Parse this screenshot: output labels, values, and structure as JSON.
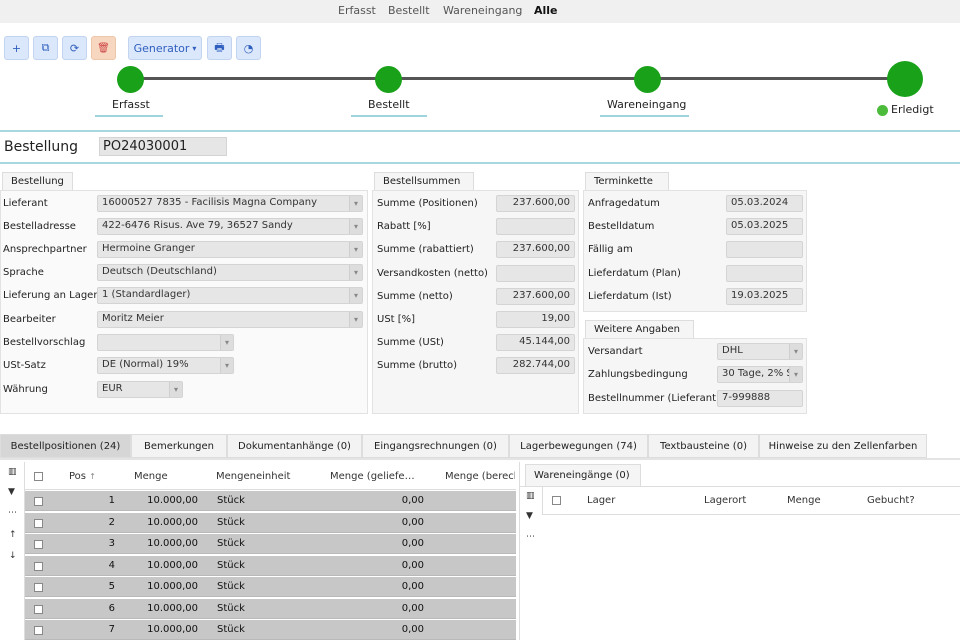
{
  "nav": {
    "items": [
      "Erfasst",
      "Bestellt",
      "Wareneingang",
      "Alle"
    ],
    "active": "Alle"
  },
  "toolbar": {
    "add": "+",
    "copy": "⧉",
    "refresh": "⟳",
    "delete": "🗑",
    "generator": "Generator",
    "generator_caret": "▾",
    "print": "🖶",
    "chart": "◔"
  },
  "progress": {
    "stages": [
      "Erfasst",
      "Bestellt",
      "Wareneingang"
    ],
    "final": "Erledigt",
    "color": "#1aa11a"
  },
  "header": {
    "label": "Bestellung",
    "number": "PO24030001"
  },
  "bestellung": {
    "tab": "Bestellung",
    "lieferant_label": "Lieferant",
    "lieferant": "16000527 7835 - Facilisis Magna Company",
    "adresse_label": "Bestelladresse",
    "adresse": "422-6476 Risus. Ave 79, 36527 Sandy",
    "ansprech_label": "Ansprechpartner",
    "ansprech": "Hermoine Granger",
    "sprache_label": "Sprache",
    "sprache": "Deutsch (Deutschland)",
    "lager_label": "Lieferung an Lager",
    "lager": "1 (Standardlager)",
    "bearbeiter_label": "Bearbeiter",
    "bearbeiter": "Moritz Meier",
    "vorschlag_label": "Bestellvorschlag",
    "vorschlag": "",
    "ust_label": "USt-Satz",
    "ust": "DE (Normal) 19%",
    "waehrung_label": "Währung",
    "waehrung": "EUR"
  },
  "summen": {
    "tab": "Bestellsummen",
    "rows": [
      {
        "label": "Summe (Positionen)",
        "value": "237.600,00"
      },
      {
        "label": "Rabatt [%]",
        "value": ""
      },
      {
        "label": "Summe (rabattiert)",
        "value": "237.600,00"
      },
      {
        "label": "Versandkosten (netto)",
        "value": ""
      },
      {
        "label": "Summe (netto)",
        "value": "237.600,00"
      },
      {
        "label": "USt [%]",
        "value": "19,00"
      },
      {
        "label": "Summe (USt)",
        "value": "45.144,00"
      },
      {
        "label": "Summe (brutto)",
        "value": "282.744,00"
      }
    ]
  },
  "termine": {
    "tab": "Terminkette",
    "rows": [
      {
        "label": "Anfragedatum",
        "value": "05.03.2024"
      },
      {
        "label": "Bestelldatum",
        "value": "05.03.2025"
      },
      {
        "label": "Fällig am",
        "value": ""
      },
      {
        "label": "Lieferdatum (Plan)",
        "value": ""
      },
      {
        "label": "Lieferdatum (Ist)",
        "value": "19.03.2025"
      }
    ]
  },
  "weitere": {
    "tab": "Weitere Angaben",
    "versandart_label": "Versandart",
    "versandart": "DHL",
    "zahlung_label": "Zahlungsbedingung",
    "zahlung": "30 Tage, 2% Sk",
    "bestellnr_label": "Bestellnummer (Lieferant)",
    "bestellnr": "7-999888"
  },
  "tabs": [
    "Bestellpositionen (24)",
    "Bemerkungen",
    "Dokumentanhänge (0)",
    "Eingangsrechnungen (0)",
    "Lagerbewegungen (74)",
    "Textbausteine (0)",
    "Hinweise zu den Zellenfarben"
  ],
  "grid": {
    "columns": [
      "Pos",
      "Menge",
      "Mengeneinheit",
      "Menge (geliefe…",
      "Menge (berech"
    ],
    "sort_icon": "↑",
    "rows": [
      {
        "pos": "1",
        "menge": "10.000,00",
        "einheit": "Stück",
        "geliefert": "0,00"
      },
      {
        "pos": "2",
        "menge": "10.000,00",
        "einheit": "Stück",
        "geliefert": "0,00"
      },
      {
        "pos": "3",
        "menge": "10.000,00",
        "einheit": "Stück",
        "geliefert": "0,00"
      },
      {
        "pos": "4",
        "menge": "10.000,00",
        "einheit": "Stück",
        "geliefert": "0,00"
      },
      {
        "pos": "5",
        "menge": "10.000,00",
        "einheit": "Stück",
        "geliefert": "0,00"
      },
      {
        "pos": "6",
        "menge": "10.000,00",
        "einheit": "Stück",
        "geliefert": "0,00"
      },
      {
        "pos": "7",
        "menge": "10.000,00",
        "einheit": "Stück",
        "geliefert": "0,00"
      }
    ]
  },
  "wareneingaenge": {
    "tab": "Wareneingänge (0)",
    "columns": [
      "Lager",
      "Lagerort",
      "Menge",
      "Gebucht?"
    ]
  },
  "side_icons": {
    "columns": "▥",
    "filter": "▼",
    "more": "⋯",
    "up": "↑",
    "down": "↓"
  }
}
